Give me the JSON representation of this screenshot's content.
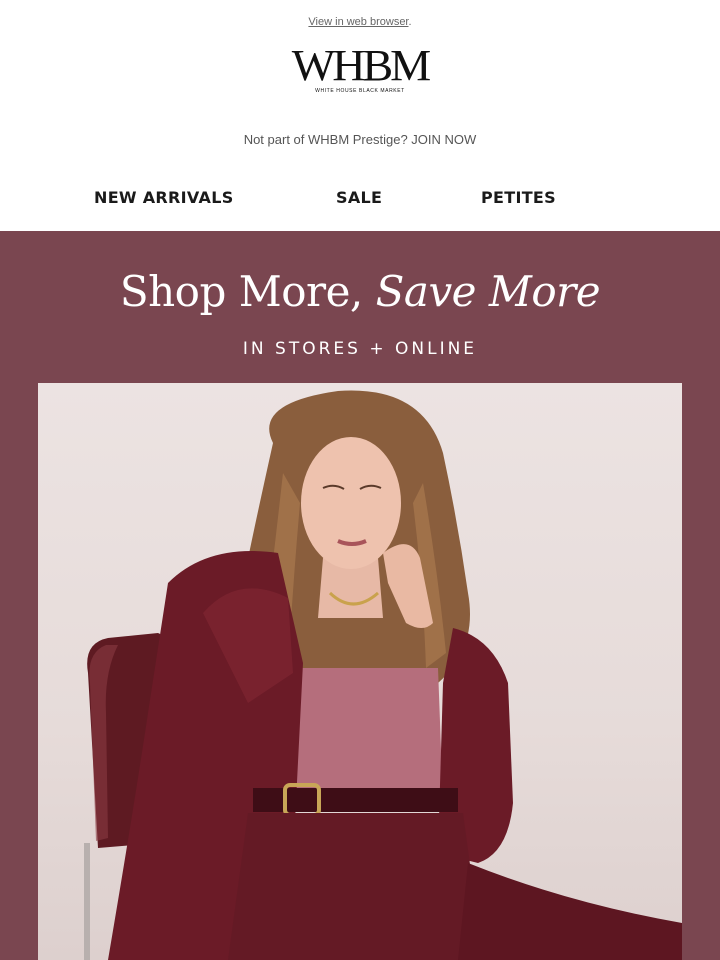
{
  "preheader": {
    "view_in_browser": "View in web browser",
    "trailing": "."
  },
  "logo": {
    "mark": "WHBM",
    "tagline": "WHITE HOUSE BLACK MARKET"
  },
  "prestige": {
    "text": "Not part of WHBM Prestige? JOIN NOW"
  },
  "nav": {
    "items": [
      {
        "label": "NEW ARRIVALS"
      },
      {
        "label": "SALE"
      },
      {
        "label": "PETITES"
      }
    ]
  },
  "hero": {
    "title_regular": "Shop More, ",
    "title_italic": "Save More",
    "subtitle": "IN STORES + ONLINE",
    "background_color": "#7a4650",
    "photo_alt_subject": "model in burgundy suit seated on chair"
  }
}
